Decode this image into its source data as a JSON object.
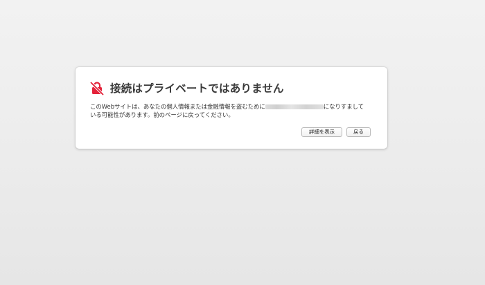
{
  "dialog": {
    "title": "接続はプライベートではありません",
    "message_line1_before": "このWebサイトは、あなたの個人情報または金融情報を盗むために",
    "message_line1_after": "になりすまして",
    "message_line2": "いる可能性があります。前のページに戻ってください。",
    "show_details_label": "詳細を表示",
    "back_label": "戻る"
  },
  "icons": {
    "warning": "broken-lock-icon"
  },
  "colors": {
    "warning_icon": "#e4223a",
    "background": "#ececec",
    "card": "#ffffff"
  }
}
